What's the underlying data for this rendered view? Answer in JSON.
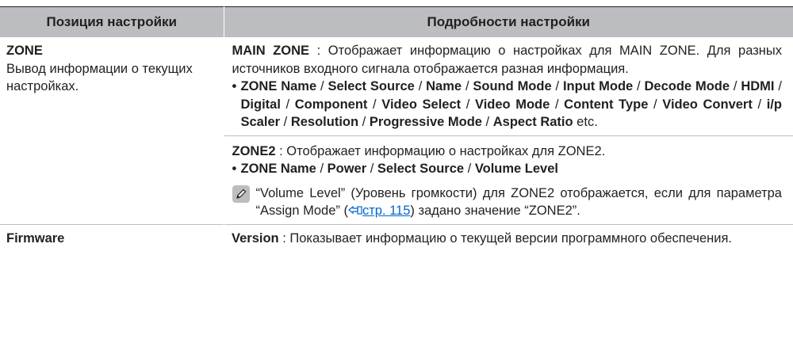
{
  "header": {
    "col1": "Позиция настройки",
    "col2": "Подробности настройки"
  },
  "zone": {
    "title": "ZONE",
    "desc": "Вывод информации о текущих настройках.",
    "main_zone": {
      "label": "MAIN ZONE",
      "text": " : Отображает информацию о настройках для MAIN ZONE. Для разных источников входного сигнала отображается разная информация.",
      "bullet": "•",
      "items": [
        "ZONE Name",
        "Select Source",
        "Name",
        "Sound Mode",
        "Input Mode",
        "Decode Mode",
        "HDMI",
        "Digital",
        "Component",
        "Video Select",
        "Video Mode",
        "Content Type",
        "Video Convert",
        "i/p Scaler",
        "Resolution",
        "Progressive Mode",
        "Aspect Ratio"
      ],
      "sep": " / ",
      "suffix": " etc."
    },
    "zone2": {
      "label": "ZONE2",
      "text": " : Отображает информацию о настройках для ZONE2.",
      "bullet": "•",
      "items": [
        "ZONE Name",
        "Power",
        "Select Source",
        "Volume Level"
      ],
      "sep": " / ",
      "note_before": "“Volume Level” (Уровень громкости) для ZONE2 отображается, если для параметра “Assign Mode” (",
      "note_link": "стр. 115",
      "note_after": ") задано значение “ZONE2”."
    }
  },
  "firmware": {
    "title": "Firmware",
    "label": "Version",
    "text": " : Показывает информацию о текущей версии программного обеспечения."
  },
  "colors": {
    "header_bg": "#bcbdc0",
    "text": "#231f20",
    "link": "#0066cc"
  }
}
